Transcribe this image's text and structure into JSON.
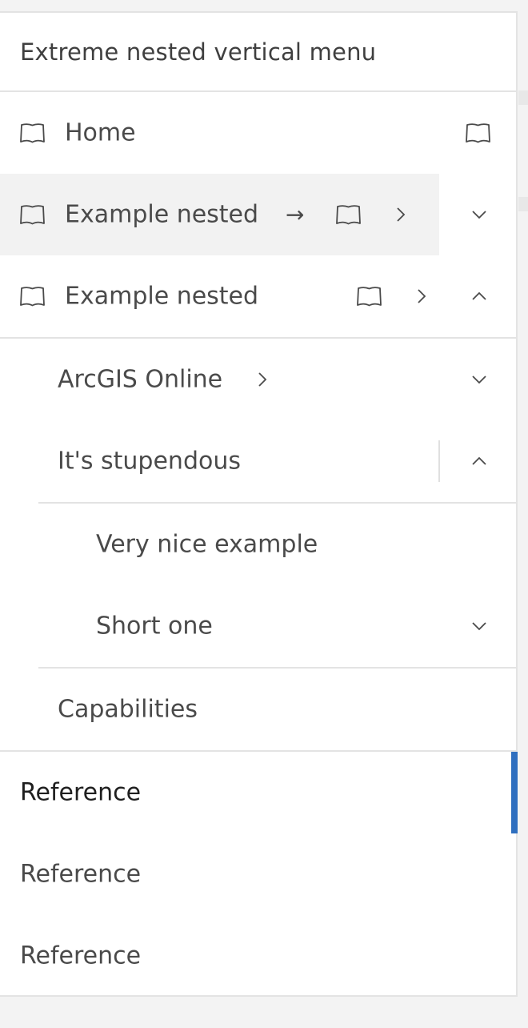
{
  "menu": {
    "title": "Extreme nested vertical menu",
    "items": [
      {
        "label": "Home",
        "icon": "book-icon",
        "end_icon": "book-icon"
      },
      {
        "label": "Example nested",
        "icon": "book-icon",
        "arrow": "→",
        "end_icon": "book-icon",
        "chevron": "chevron-right-icon",
        "toggle": "chevron-down-icon",
        "state": "hover"
      },
      {
        "label": "Example nested",
        "icon": "book-icon",
        "end_icon": "book-icon",
        "chevron": "chevron-right-icon",
        "toggle": "chevron-up-icon",
        "state": "expanded"
      }
    ],
    "children": [
      {
        "label": "ArcGIS Online",
        "chevron": "chevron-right-icon",
        "toggle": "chevron-down-icon"
      },
      {
        "label": "It's stupendous",
        "toggle": "chevron-up-icon",
        "state": "expanded"
      }
    ],
    "grandchildren": [
      {
        "label": "Very nice example"
      },
      {
        "label": "Short one",
        "toggle": "chevron-down-icon"
      }
    ],
    "capabilities": {
      "label": "Capabilities"
    },
    "references": [
      {
        "label": "Reference",
        "current": true
      },
      {
        "label": "Reference"
      },
      {
        "label": "Reference"
      }
    ]
  },
  "colors": {
    "accent": "#2f6fbf",
    "hover_bg": "#f2f2f2",
    "border": "#e3e3e3",
    "text": "#4a4a4a"
  }
}
